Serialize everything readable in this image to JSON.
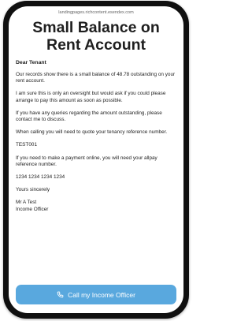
{
  "browser": {
    "url": "landingpages.richcontent.esendex.com"
  },
  "page": {
    "title": "Small Balance on Rent Account"
  },
  "letter": {
    "greeting": "Dear Tenant",
    "paragraph_1": "Our records show there is a small balance of 48.78 outstanding on your rent account.",
    "paragraph_2": "I am sure this is only an oversight but would ask if you could please arrange to pay this amount as soon as possible.",
    "paragraph_3": "If you have any queries regarding the amount outstanding, please contact me to discuss.",
    "paragraph_4": "When calling you will need to quote your tenancy reference number.",
    "tenancy_reference": "TEST001",
    "paragraph_5": "If you need to make a payment online, you will need your allpay reference number.",
    "allpay_reference": "1234 1234 1234 1234",
    "sign_off": "Yours sincerely",
    "sender_name": "Mr A Test",
    "sender_title": "Income Officer"
  },
  "cta": {
    "label": "Call my Income Officer",
    "icon": "phone-icon"
  },
  "colors": {
    "cta_background": "#59a8de",
    "phone_frame": "#101010"
  }
}
